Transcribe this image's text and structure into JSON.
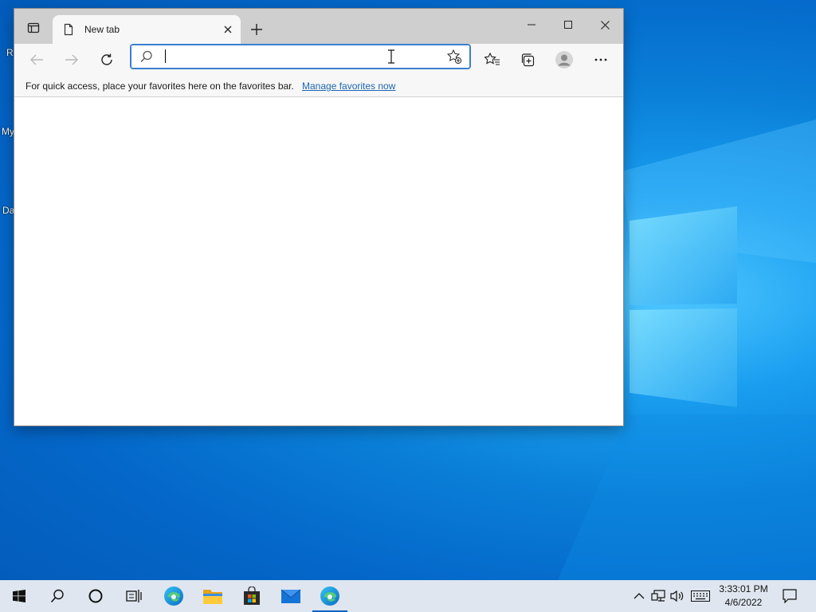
{
  "desktop": {
    "icon_labels": [
      "R",
      "My",
      "Da"
    ]
  },
  "browser": {
    "tab": {
      "title": "New tab"
    },
    "address_bar": {
      "value": "",
      "placeholder": ""
    },
    "favorites_bar": {
      "message": "For quick access, place your favorites here on the favorites bar.",
      "link": "Manage favorites now"
    },
    "icons": {
      "tab_actions": "tab-actions-icon",
      "page": "page-icon",
      "close_tab": "close-icon",
      "new_tab": "plus-icon",
      "minimize": "minimize-icon",
      "maximize": "maximize-icon",
      "close_window": "close-icon",
      "back": "back-arrow-icon",
      "forward": "forward-arrow-icon",
      "refresh": "refresh-icon",
      "search": "search-icon",
      "add_favorite": "star-add-icon",
      "favorites": "favorites-icon",
      "collections": "collections-icon",
      "profile": "profile-icon",
      "menu": "more-icon"
    }
  },
  "taskbar": {
    "items": [
      "start",
      "search",
      "cortana",
      "task-view",
      "edge",
      "file-explorer",
      "store",
      "mail",
      "edge-active"
    ],
    "clock": {
      "time": "3:33:01 PM",
      "date": "4/6/2022"
    }
  },
  "colors": {
    "accent": "#0a64c8",
    "link": "#1b66b3",
    "taskbar": "#dfe6ef"
  }
}
